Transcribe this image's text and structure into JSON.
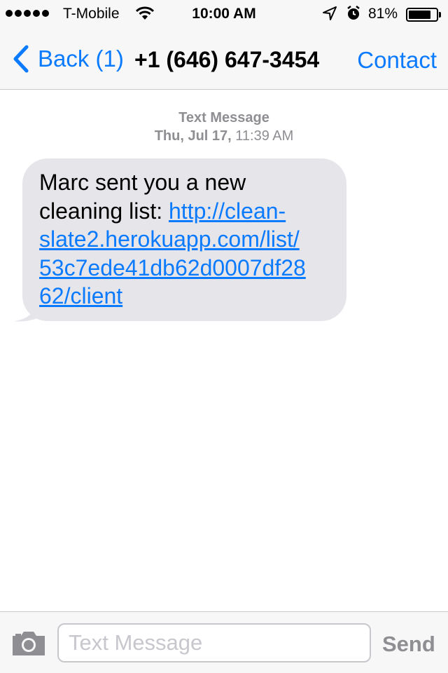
{
  "status_bar": {
    "signal_dots": 5,
    "carrier": "T-Mobile",
    "time": "10:00 AM",
    "battery_percent": "81%",
    "battery_level": 0.81,
    "icons": [
      "wifi-icon",
      "location-arrow-icon",
      "alarm-icon",
      "battery-icon"
    ]
  },
  "nav": {
    "back_label": "Back (1)",
    "title": "+1 (646) 647-3454",
    "contact_label": "Contact"
  },
  "thread": {
    "header_title": "Text Message",
    "header_date": "Thu, Jul 17,",
    "header_time": " 11:39 AM"
  },
  "message": {
    "text_before": "Marc sent you a new cleaning list: ",
    "link_text": "http://clean-slate2.herokuapp.com/list/53c7ede41db62d0007df2862/client",
    "link_line1": "http://clean-",
    "link_line2": "slate2.herokuapp.com/list/",
    "link_line3": "53c7ede41db62d0007df28",
    "link_line4": "62/client"
  },
  "input_bar": {
    "placeholder": "Text Message",
    "value": "",
    "send_label": "Send",
    "camera_icon": "camera-icon"
  },
  "colors": {
    "accent": "#0a7aff",
    "bubble": "#e5e5ea",
    "bar_background": "#f7f7f8",
    "muted": "#8e8e93"
  }
}
